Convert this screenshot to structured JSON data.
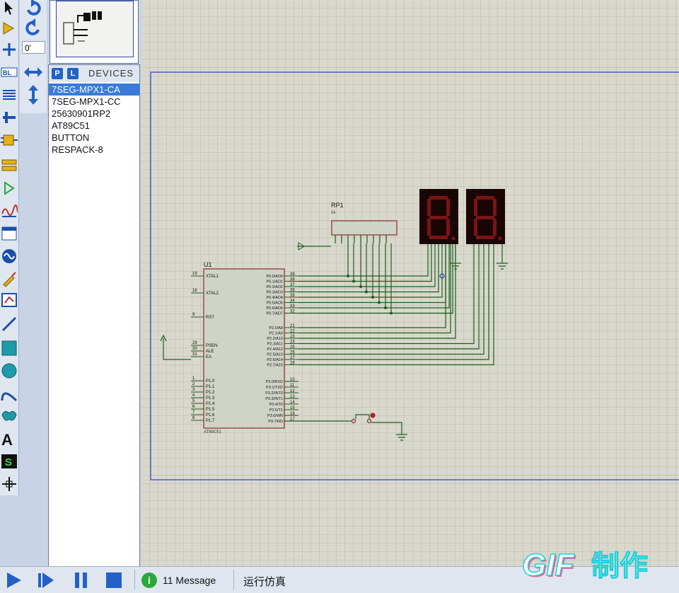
{
  "toolbar_angle": "0'",
  "devices": {
    "p_label": "P",
    "l_label": "L",
    "title": "DEVICES",
    "items": [
      "7SEG-MPX1-CA",
      "7SEG-MPX1-CC",
      "25630901RP2",
      "AT89C51",
      "BUTTON",
      "RESPACK-8"
    ],
    "selected_index": 0
  },
  "schematic": {
    "rp1_ref": "RP1",
    "rp1_value": "1k",
    "u1_ref": "U1",
    "u1_part": "AT89C51",
    "left_pins": [
      {
        "num": "19",
        "name": "XTAL1"
      },
      {
        "num": "18",
        "name": "XTAL2"
      },
      {
        "num": "9",
        "name": "RST"
      },
      {
        "num": "29",
        "name": "PSEN"
      },
      {
        "num": "30",
        "name": "ALE"
      },
      {
        "num": "31",
        "name": "EA"
      },
      {
        "num": "1",
        "name": "P1.0"
      },
      {
        "num": "2",
        "name": "P1.1"
      },
      {
        "num": "3",
        "name": "P1.2"
      },
      {
        "num": "4",
        "name": "P1.3"
      },
      {
        "num": "5",
        "name": "P1.4"
      },
      {
        "num": "6",
        "name": "P1.5"
      },
      {
        "num": "7",
        "name": "P1.6"
      },
      {
        "num": "8",
        "name": "P1.7"
      }
    ],
    "right_pins": [
      {
        "num": "39",
        "name": "P0.0/AD0"
      },
      {
        "num": "38",
        "name": "P0.1/AD1"
      },
      {
        "num": "37",
        "name": "P0.2/AD2"
      },
      {
        "num": "36",
        "name": "P0.3/AD3"
      },
      {
        "num": "35",
        "name": "P0.4/AD4"
      },
      {
        "num": "34",
        "name": "P0.5/AD5"
      },
      {
        "num": "33",
        "name": "P0.6/AD6"
      },
      {
        "num": "32",
        "name": "P0.7/AD7"
      },
      {
        "num": "21",
        "name": "P2.0/A8"
      },
      {
        "num": "22",
        "name": "P2.1/A9"
      },
      {
        "num": "23",
        "name": "P2.2/A10"
      },
      {
        "num": "24",
        "name": "P2.3/A11"
      },
      {
        "num": "25",
        "name": "P2.4/A12"
      },
      {
        "num": "26",
        "name": "P2.5/A13"
      },
      {
        "num": "27",
        "name": "P2.6/A14"
      },
      {
        "num": "28",
        "name": "P2.7/A15"
      },
      {
        "num": "10",
        "name": "P3.0/RXD"
      },
      {
        "num": "11",
        "name": "P3.1/TXD"
      },
      {
        "num": "12",
        "name": "P3.2/INT0"
      },
      {
        "num": "13",
        "name": "P3.3/INT1"
      },
      {
        "num": "14",
        "name": "P3.4/T0"
      },
      {
        "num": "15",
        "name": "P3.5/T1"
      },
      {
        "num": "16",
        "name": "P3.6/WR"
      },
      {
        "num": "17",
        "name": "P3.7/RD"
      }
    ]
  },
  "status": {
    "message_count": "11 Message",
    "sim_status": "运行仿真"
  },
  "watermark": "GIF制作",
  "colors": {
    "grid_bg": "#d9d8cc",
    "grid_line": "#bab9ab",
    "sheet_border": "#2b3cc4",
    "wire": "#1c5f1c",
    "chip_fill": "#cfd4c7",
    "chip_border": "#8a2a2a",
    "seg_body": "#1a0505",
    "seg_on": "#7a1515",
    "accent_blue": "#2461c7"
  }
}
